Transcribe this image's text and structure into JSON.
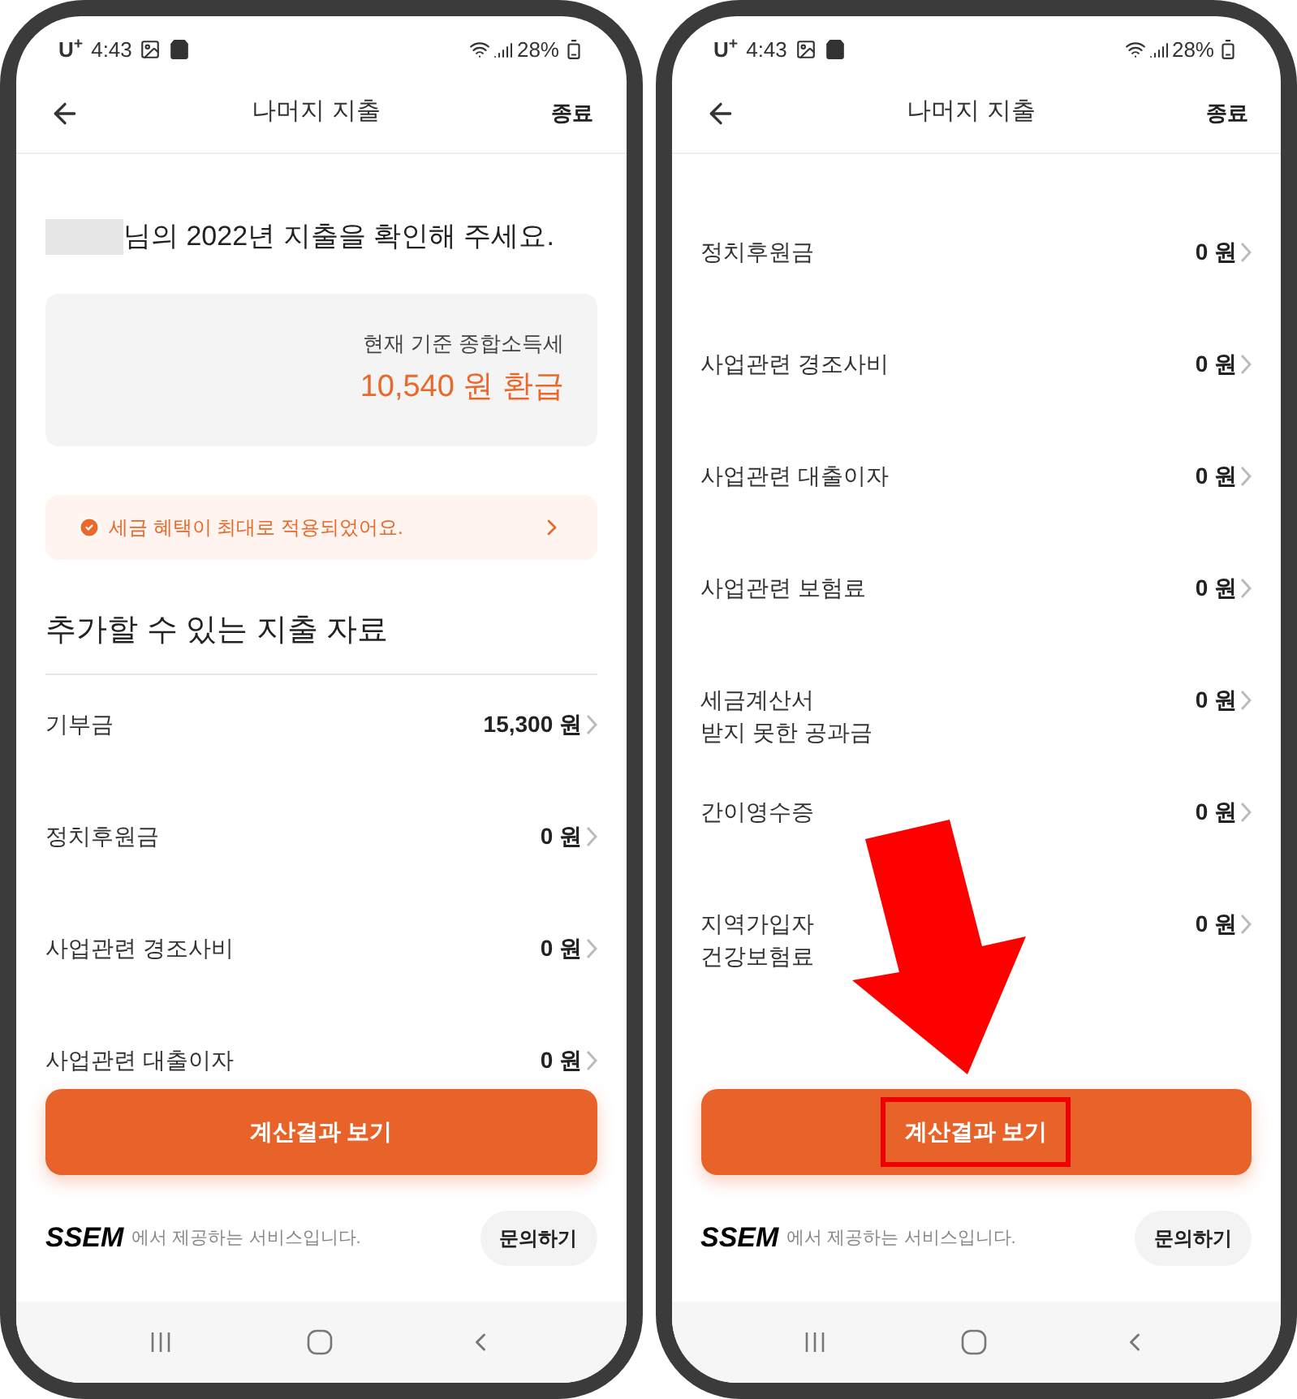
{
  "phones": [
    {
      "status_bar": {
        "carrier": "U$^{+}$",
        "time": "4:43",
        "battery": "28%"
      },
      "header": {
        "title": "나머지 지출",
        "close": "종료"
      },
      "greeting": {
        "name_blurred": true,
        "text": "님의 2022년 지출을 확인해 주세요."
      },
      "summary": {
        "label": "현재 기준 종합소득세",
        "amount": "10,540 원 환급"
      },
      "notice": {
        "text": "세금 혜택이 최대로 적용되었어요."
      },
      "section_title": "추가할 수 있는 지출 자료",
      "rows": [
        {
          "label": "기부금",
          "value": "15,300 원"
        },
        {
          "label": "정치후원금",
          "value": "0 원"
        },
        {
          "label": "사업관련 경조사비",
          "value": "0 원"
        },
        {
          "label": "사업관련 대출이자",
          "value": "0 원"
        }
      ],
      "cta_button": {
        "label": "계산결과 보기",
        "highlighted": false
      },
      "footer": {
        "brand": "SSEM",
        "text": "에서 제공하는 서비스입니다.",
        "help": "문의하기"
      },
      "arrow": false
    },
    {
      "status_bar": {
        "carrier": "U$^{+}$",
        "time": "4:43",
        "battery": "28%"
      },
      "header": {
        "title": "나머지 지출",
        "close": "종료"
      },
      "rows": [
        {
          "label": "정치후원금",
          "value": "0 원"
        },
        {
          "label": "사업관련 경조사비",
          "value": "0 원"
        },
        {
          "label": "사업관련 대출이자",
          "value": "0 원"
        },
        {
          "label": "사업관련 보험료",
          "value": "0 원"
        },
        {
          "label": "세금계산서\n받지 못한 공과금",
          "value": "0 원"
        },
        {
          "label": "간이영수증",
          "value": "0 원"
        },
        {
          "label": "지역가입자\n건강보험료",
          "value": "0 원"
        }
      ],
      "cta_button": {
        "label": "계산결과 보기",
        "highlighted": true
      },
      "footer": {
        "brand": "SSEM",
        "text": "에서 제공하는 서비스입니다.",
        "help": "문의하기"
      },
      "arrow": true
    }
  ]
}
